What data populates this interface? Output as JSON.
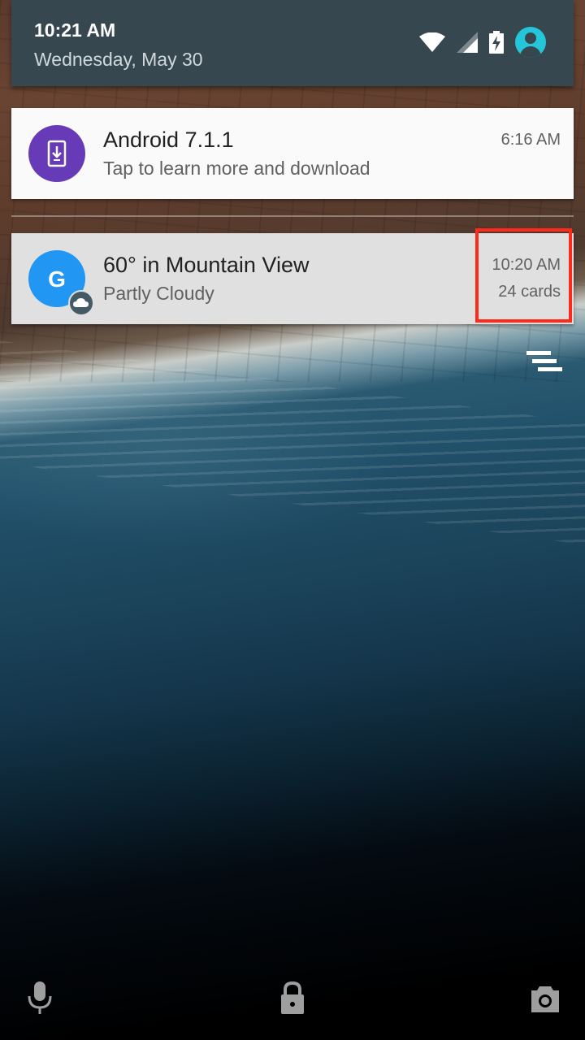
{
  "status": {
    "time": "10:21 AM",
    "date": "Wednesday, May 30",
    "icons": [
      "wifi-icon",
      "cell-signal-icon",
      "battery-charging-icon",
      "user-avatar-icon"
    ]
  },
  "notifications": [
    {
      "app_icon": "system-update-icon",
      "icon_color": "#673ab7",
      "title": "Android 7.1.1",
      "text": "Tap to learn more and download",
      "time": "6:16 AM"
    },
    {
      "app_icon": "google-g-icon",
      "icon_color": "#2196f3",
      "badge_icon": "cloud-icon",
      "title": "60° in Mountain View",
      "text": "Partly Cloudy",
      "time": "10:20 AM",
      "count": "24 cards"
    }
  ],
  "lockscreen": {
    "left_affordance": "microphone-icon",
    "center_affordance": "lock-icon",
    "right_affordance": "camera-icon"
  },
  "colors": {
    "header_bg": "#37474f",
    "highlight": "#ff2a1a"
  }
}
